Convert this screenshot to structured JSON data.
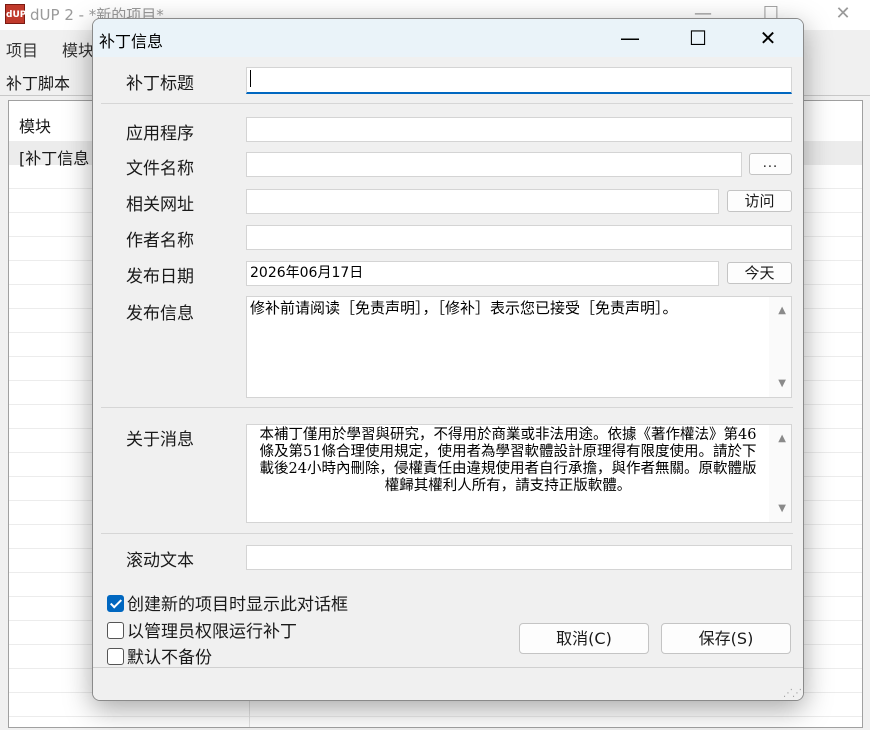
{
  "main_window": {
    "title": "dUP 2 - *新的项目*",
    "logo_text": "dUP",
    "menu": [
      "项目",
      "模块"
    ],
    "tab": "补丁脚本",
    "list_header": "模块",
    "list_row": "[补丁信息"
  },
  "dialog": {
    "title": "补丁信息",
    "fields": {
      "patch_title": {
        "label": "补丁标题",
        "value": ""
      },
      "application": {
        "label": "应用程序",
        "value": ""
      },
      "file_name": {
        "label": "文件名称",
        "value": "",
        "browse_label": "..."
      },
      "related_url": {
        "label": "相关网址",
        "value": "",
        "visit_label": "访问"
      },
      "author": {
        "label": "作者名称",
        "value": ""
      },
      "release_date": {
        "label": "发布日期",
        "value": "2026年06月17日",
        "today_label": "今天"
      },
      "release_info": {
        "label": "发布信息",
        "value": "修补前请阅读［免责声明］，［修补］表示您已接受［免责声明］。"
      },
      "about": {
        "label": "关于消息",
        "value": "本補丁僅用於學習與研究，不得用於商業或非法用途。依據《著作權法》第46條及第51條合理使用規定，使用者為學習軟體設計原理得有限度使用。請於下載後24小時內刪除，侵權責任由違規使用者自行承擔，與作者無關。原軟體版權歸其權利人所有，請支持正版軟體。"
      },
      "scroll_text": {
        "label": "滚动文本",
        "value": ""
      }
    },
    "checkboxes": [
      {
        "label": "创建新的项目时显示此对话框",
        "checked": true
      },
      {
        "label": "以管理员权限运行补丁",
        "checked": false
      },
      {
        "label": "默认不备份",
        "checked": false
      }
    ],
    "buttons": {
      "cancel": "取消(C)",
      "save": "保存(S)"
    }
  },
  "colors": {
    "accent": "#0067c0",
    "title_bar": "#eaf3f9"
  }
}
